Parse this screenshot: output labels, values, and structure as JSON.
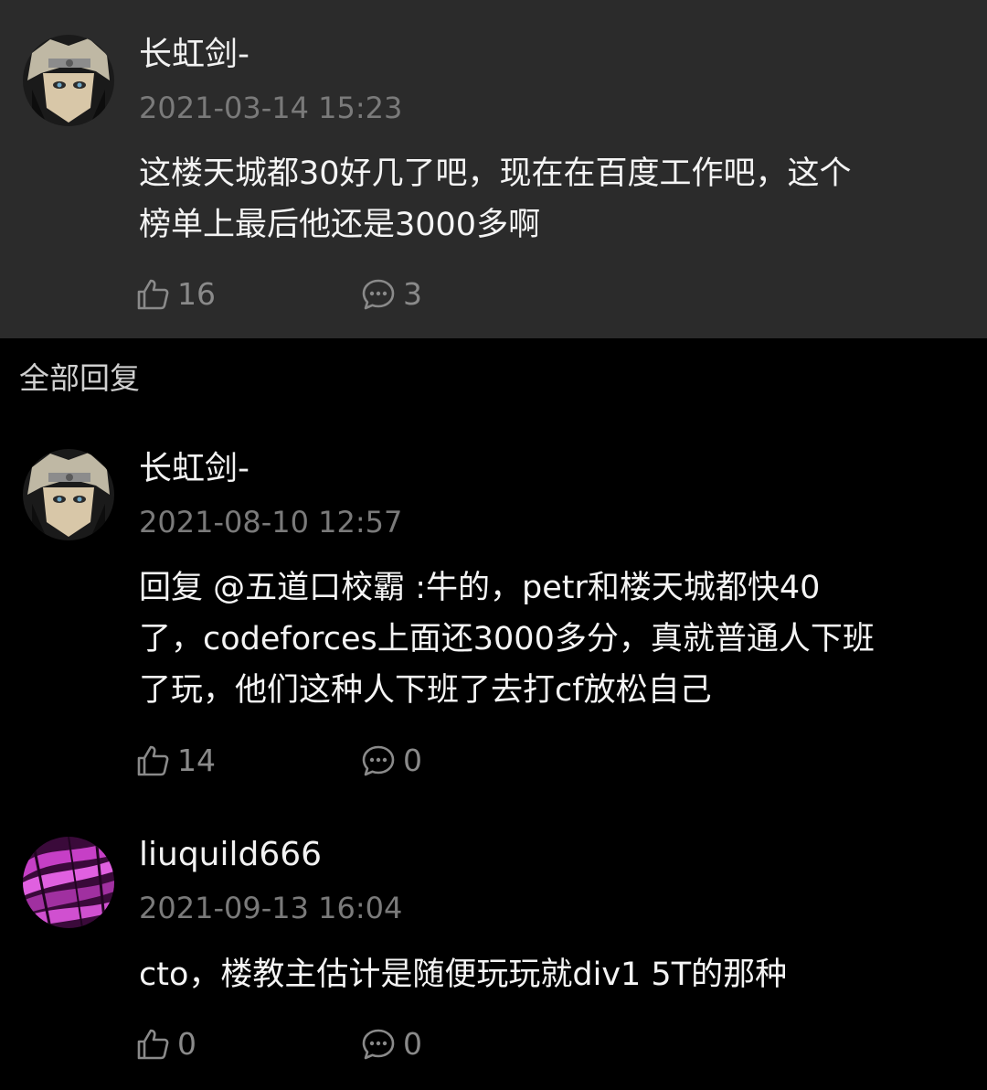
{
  "main_comment": {
    "username": "长虹剑-",
    "timestamp": "2021-03-14 15:23",
    "text_lines": [
      "这楼天城都30好几了吧，现在在百度工作吧，这个",
      "榜单上最后他还是3000多啊"
    ],
    "likes": "16",
    "replies": "3",
    "avatar_icon": "anime-avatar-icon"
  },
  "section_label": "全部回复",
  "replies": [
    {
      "username": "长虹剑-",
      "timestamp": "2021-08-10 12:57",
      "text_lines": [
        "回复 @五道口校霸 :牛的，petr和楼天城都快40",
        "了，codeforces上面还3000多分，真就普通人下班",
        "了玩，他们这种人下班了去打cf放松自己"
      ],
      "likes": "14",
      "replies": "0",
      "avatar_icon": "anime-avatar-icon"
    },
    {
      "username": "liuquild666",
      "timestamp": "2021-09-13 16:04",
      "text_lines": [
        "cto，楼教主估计是随便玩玩就div1 5T的那种"
      ],
      "likes": "0",
      "replies": "0",
      "avatar_icon": "purple-abstract-avatar-icon"
    }
  ],
  "colors": {
    "background": "#000000",
    "card_background": "#2b2b2b",
    "timestamp": "#7a7a7a",
    "count": "#8a8a8a"
  }
}
